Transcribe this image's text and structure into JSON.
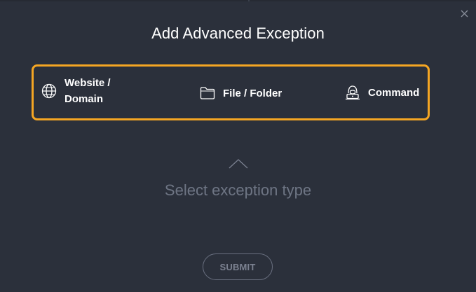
{
  "dialog": {
    "title": "Add Advanced Exception",
    "close_icon": "close-icon"
  },
  "exception_types": [
    {
      "label": "Website / Domain",
      "icon": "globe-icon"
    },
    {
      "label": "File / Folder",
      "icon": "folder-icon"
    },
    {
      "label": "Command",
      "icon": "hacker-icon"
    }
  ],
  "hint": {
    "text": "Select exception type"
  },
  "actions": {
    "submit_label": "SUBMIT"
  },
  "colors": {
    "background": "#2b303b",
    "highlight": "#f5a623",
    "hint_text": "#6e7584"
  }
}
